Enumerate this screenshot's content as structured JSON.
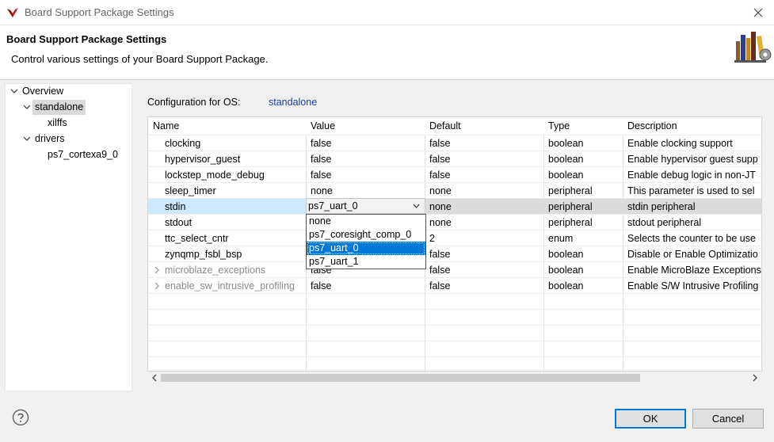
{
  "window": {
    "title": "Board Support Package Settings"
  },
  "header": {
    "title": "Board Support Package Settings",
    "description": "Control various settings of your Board Support Package."
  },
  "tree": {
    "items": [
      {
        "label": "Overview",
        "level": 0,
        "expanded": true
      },
      {
        "label": "standalone",
        "level": 1,
        "expanded": true,
        "selected": true
      },
      {
        "label": "xilffs",
        "level": 2
      },
      {
        "label": "drivers",
        "level": 1,
        "expanded": true
      },
      {
        "label": "ps7_cortexa9_0",
        "level": 2
      }
    ]
  },
  "config": {
    "label": "Configuration for OS:",
    "value": "standalone"
  },
  "table": {
    "columns": [
      "Name",
      "Value",
      "Default",
      "Type",
      "Description"
    ],
    "rows": [
      {
        "name": "clocking",
        "value": "false",
        "default": "false",
        "type": "boolean",
        "description": "Enable clocking support"
      },
      {
        "name": "hypervisor_guest",
        "value": "false",
        "default": "false",
        "type": "boolean",
        "description": "Enable hypervisor guest supp"
      },
      {
        "name": "lockstep_mode_debug",
        "value": "false",
        "default": "false",
        "type": "boolean",
        "description": "Enable debug logic in non-JT"
      },
      {
        "name": "sleep_timer",
        "value": "none",
        "default": "none",
        "type": "peripheral",
        "description": "This parameter is used to sel"
      },
      {
        "name": "stdin",
        "value": "ps7_uart_0",
        "default": "none",
        "type": "peripheral",
        "description": "stdin peripheral"
      },
      {
        "name": "stdout",
        "value": "",
        "default": "none",
        "type": "peripheral",
        "description": "stdout peripheral"
      },
      {
        "name": "ttc_select_cntr",
        "value": "",
        "default": "2",
        "type": "enum",
        "description": "Selects the counter to be use"
      },
      {
        "name": "zynqmp_fsbl_bsp",
        "value": "",
        "default": "false",
        "type": "boolean",
        "description": "Disable or Enable Optimizatio"
      },
      {
        "name": "microblaze_exceptions",
        "value": "false",
        "default": "false",
        "type": "boolean",
        "description": "Enable MicroBlaze Exceptions",
        "expandable": true,
        "disabled": true
      },
      {
        "name": "enable_sw_intrusive_profiling",
        "value": "false",
        "default": "false",
        "type": "boolean",
        "description": "Enable S/W Intrusive Profiling",
        "expandable": true,
        "disabled": true
      }
    ]
  },
  "dropdown": {
    "selected": "ps7_uart_0",
    "options": [
      "none",
      "ps7_coresight_comp_0",
      "ps7_uart_0",
      "ps7_uart_1"
    ]
  },
  "buttons": {
    "ok": "OK",
    "cancel": "Cancel"
  },
  "colors": {
    "accent": "#0078d7",
    "link": "#1c3e9b",
    "selected_name": "#cde8ff",
    "selected_row": "#dcdcdc"
  }
}
